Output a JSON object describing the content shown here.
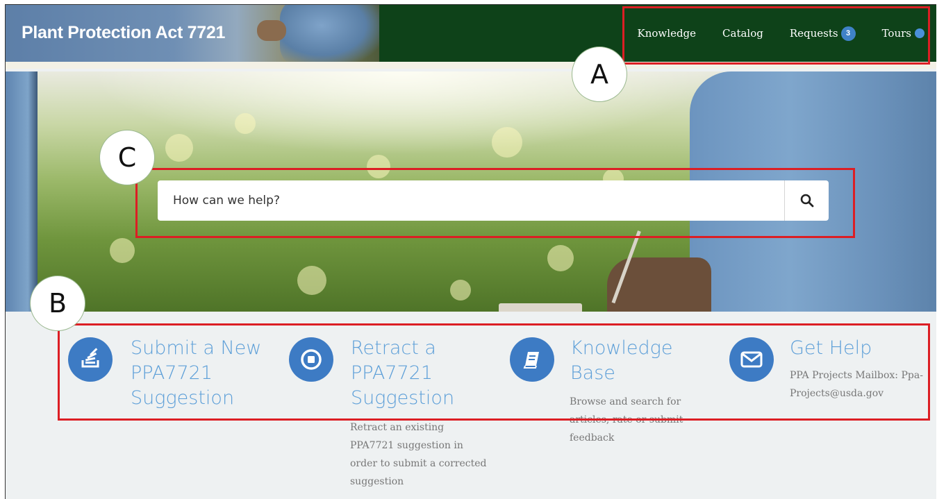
{
  "header": {
    "title": "Plant Protection Act 7721",
    "nav": [
      {
        "label": "Knowledge"
      },
      {
        "label": "Catalog"
      },
      {
        "label": "Requests",
        "badge": "3"
      },
      {
        "label": "Tours",
        "indicator": "blue-dot"
      }
    ]
  },
  "search": {
    "placeholder": "How can we help?",
    "button_icon": "search-icon"
  },
  "cards": [
    {
      "title": "Submit a New PPA7721 Suggestion",
      "description": "",
      "icon": "stack-icon"
    },
    {
      "title": "Retract a PPA7721 Suggestion",
      "description": "Retract an existing PPA7721 suggestion in order to submit a corrected suggestion",
      "icon": "stop-icon"
    },
    {
      "title": "Knowledge Base",
      "description": "Browse and search for articles, rate or submit feedback",
      "icon": "book-icon"
    },
    {
      "title": "Get Help",
      "description": "PPA Projects Mailbox: Ppa-Projects@usda.gov",
      "icon": "envelope-icon"
    }
  ],
  "annotations": {
    "a": "A",
    "b": "B",
    "c": "C"
  },
  "colors": {
    "header_bg": "#0e4219",
    "accent_blue": "#3d7bc4",
    "title_blue": "#5d9fd8",
    "annotation_red": "#dc1e24"
  }
}
